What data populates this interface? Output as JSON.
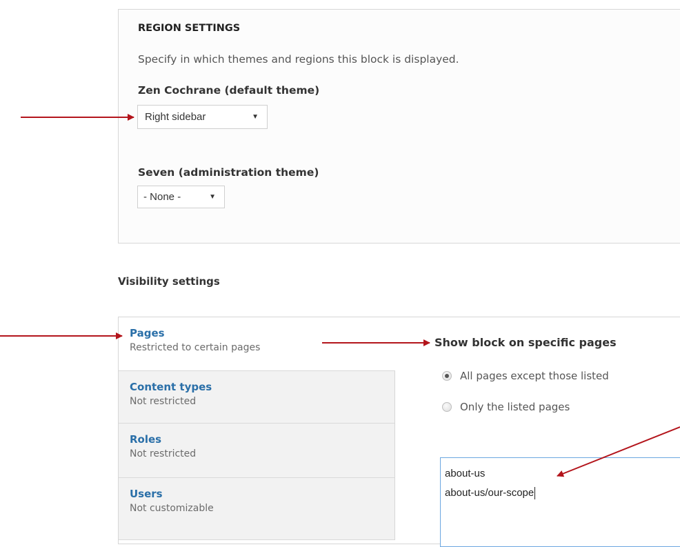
{
  "region_settings": {
    "title": "REGION SETTINGS",
    "description": "Specify in which themes and regions this block is displayed.",
    "themes": [
      {
        "label": "Zen Cochrane (default theme)",
        "selected": "Right sidebar"
      },
      {
        "label": "Seven (administration theme)",
        "selected": "- None -"
      }
    ]
  },
  "visibility": {
    "heading": "Visibility settings",
    "tabs": [
      {
        "title": "Pages",
        "summary": "Restricted to certain pages",
        "active": true
      },
      {
        "title": "Content types",
        "summary": "Not restricted"
      },
      {
        "title": "Roles",
        "summary": "Not restricted"
      },
      {
        "title": "Users",
        "summary": "Not customizable"
      }
    ],
    "pane": {
      "title": "Show block on specific pages",
      "options": [
        {
          "label": "All pages except those listed",
          "checked": true
        },
        {
          "label": "Only the listed pages",
          "checked": false
        }
      ],
      "pages_lines": [
        "about-us",
        "about-us/our-scope"
      ]
    }
  },
  "icons": {
    "dropdown_arrow": "▼",
    "annotation_arrow_color": "#b3141b"
  }
}
